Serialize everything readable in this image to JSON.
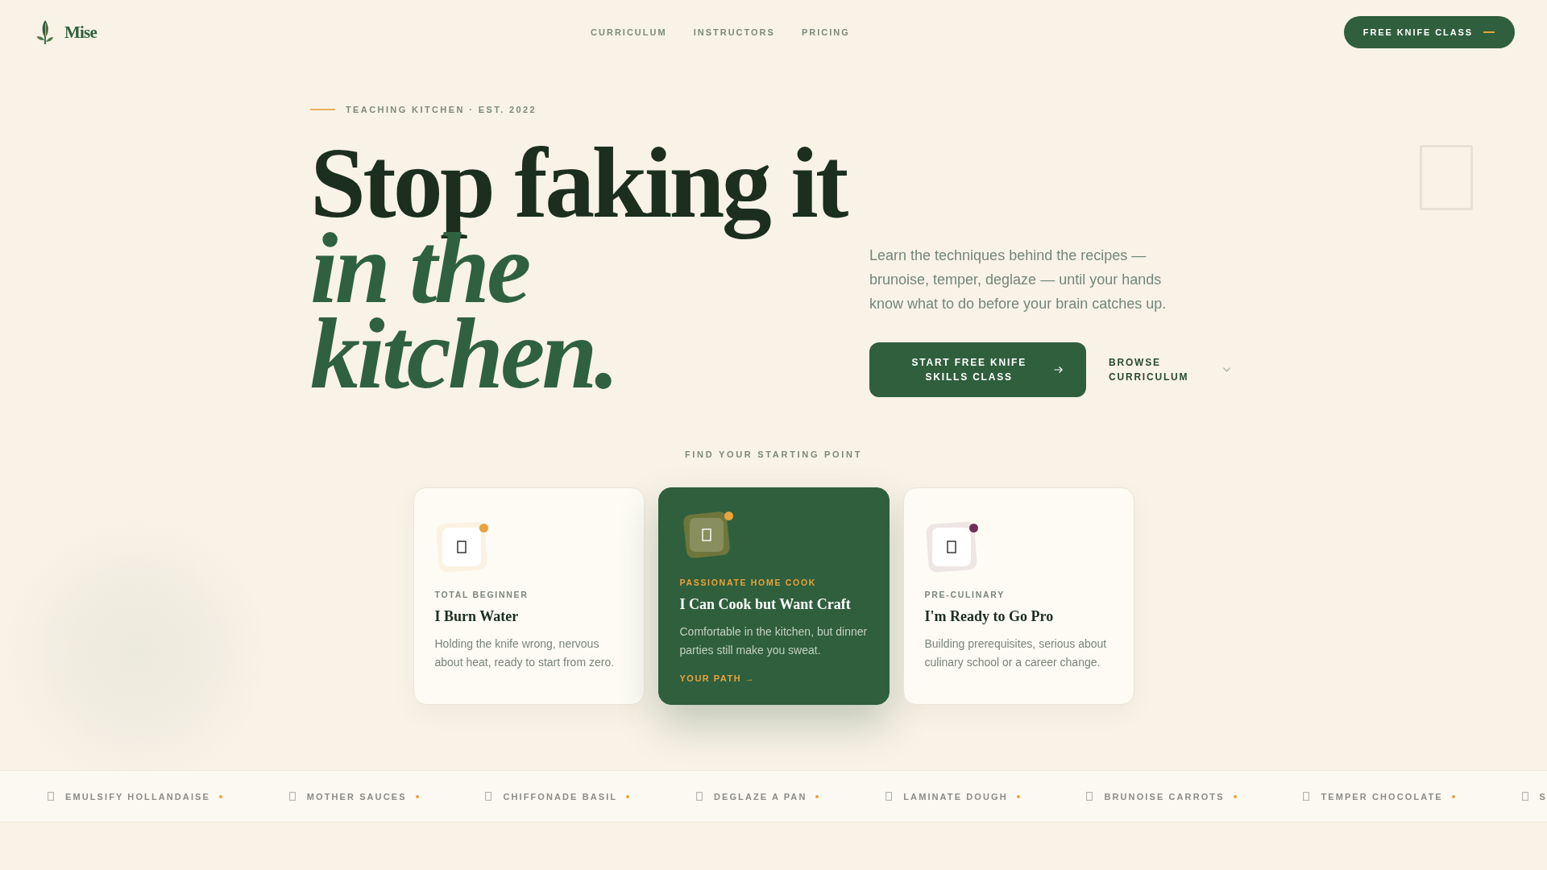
{
  "header": {
    "logo": {
      "name": "Mise"
    },
    "nav": [
      {
        "label": "CURRICULUM"
      },
      {
        "label": "INSTRUCTORS"
      },
      {
        "label": "PRICING"
      }
    ],
    "cta": {
      "label": "FREE KNIFE CLASS"
    }
  },
  "hero": {
    "eyebrow": "TEACHING KITCHEN · EST. 2022",
    "headline": [
      {
        "text": "Stop faking it",
        "kind": "roman"
      },
      {
        "text": "in the",
        "kind": "italic"
      },
      {
        "text": "kitchen.",
        "kind": "italic"
      }
    ],
    "description": "Learn the techniques behind the recipes — brunoise, temper, deglaze — until your hands know what to do before your brain catches up.",
    "primary_button": {
      "label": "START FREE KNIFE SKILLS CLASS"
    },
    "secondary_button": {
      "label": "BROWSE CURRICULUM"
    }
  },
  "starting_point": {
    "heading": "FIND YOUR STARTING POINT",
    "cards": [
      {
        "eyebrow": "TOTAL BEGINNER",
        "title": "I Burn Water",
        "description": "Holding the knife wrong, nervous about heat, ready to start from zero.",
        "color": "#e8a33a",
        "selected": false
      },
      {
        "eyebrow": "PASSIONATE HOME COOK",
        "title": "I Can Cook but Want Craft",
        "description": "Comfortable in the kitchen, but dinner parties still make you sweat.",
        "link": "YOUR PATH →",
        "color": "#e8a33a",
        "selected": true
      },
      {
        "eyebrow": "PRE-CULINARY",
        "title": "I'm Ready to Go Pro",
        "description": "Building prerequisites, serious about culinary school or a career change.",
        "color": "#6e2f55",
        "selected": false
      }
    ]
  },
  "skills_ticker": [
    {
      "label": "EMULSIFY HOLLANDAISE"
    },
    {
      "label": "MOTHER SAUCES"
    },
    {
      "label": "CHIFFONADE BASIL"
    },
    {
      "label": "DEGLAZE A PAN"
    },
    {
      "label": "LAMINATE DOUGH"
    },
    {
      "label": "BRUNOISE CARROTS"
    },
    {
      "label": "TEMPER CHOCOLATE"
    },
    {
      "label": "S"
    }
  ]
}
